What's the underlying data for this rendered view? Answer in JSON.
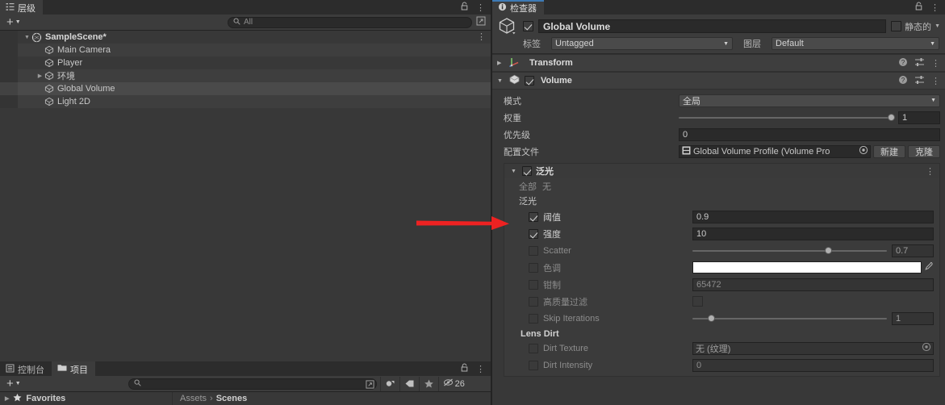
{
  "hierarchy": {
    "tab_label": "层级",
    "tab_icon": "hierarchy-icon",
    "lock_icon": "lock-icon",
    "menu_icon": "kebab-menu-icon",
    "add_label": "+",
    "search_placeholder": "All",
    "search_value": "",
    "items": [
      {
        "label": "SampleScene*",
        "icon": "unity-scene-icon",
        "depth": 0,
        "foldout": "open",
        "selected": false,
        "type": "scene"
      },
      {
        "label": "Main Camera",
        "icon": "gameobject-icon",
        "depth": 1,
        "foldout": "none",
        "selected": false,
        "type": "go"
      },
      {
        "label": "Player",
        "icon": "gameobject-icon",
        "depth": 1,
        "foldout": "none",
        "selected": false,
        "type": "go"
      },
      {
        "label": "环境",
        "icon": "gameobject-icon",
        "depth": 1,
        "foldout": "closed",
        "selected": false,
        "type": "go"
      },
      {
        "label": "Global Volume",
        "icon": "gameobject-icon",
        "depth": 1,
        "foldout": "none",
        "selected": true,
        "type": "go"
      },
      {
        "label": "Light 2D",
        "icon": "gameobject-icon",
        "depth": 1,
        "foldout": "none",
        "selected": false,
        "type": "go"
      }
    ]
  },
  "project_panel": {
    "tabs": [
      {
        "label": "控制台",
        "icon": "console-icon",
        "active": false
      },
      {
        "label": "项目",
        "icon": "folder-icon",
        "active": true
      }
    ],
    "lock_icon": "lock-icon",
    "menu_icon": "kebab-menu-icon",
    "add_label": "+",
    "search_value": "",
    "icon_buttons": [
      {
        "name": "search-expand-icon"
      },
      {
        "name": "asset-type-filter-icon"
      },
      {
        "name": "label-filter-icon"
      },
      {
        "name": "favorites-filter-icon"
      }
    ],
    "hidden_count": "26",
    "hidden_icon": "hidden-eye-icon",
    "favorites_label": "Favorites",
    "favorites_icon": "star-icon",
    "breadcrumb": [
      "Assets",
      "Scenes"
    ],
    "breadcrumb_sep": "›"
  },
  "inspector": {
    "tab_label": "检查器",
    "tab_icon": "info-icon",
    "lock_icon": "lock-icon",
    "menu_icon": "kebab-menu-icon",
    "object": {
      "icon": "prefab-cube-icon",
      "enabled": true,
      "name": "Global Volume",
      "static_label": "静态的",
      "static_checked": false,
      "tag_label": "标签",
      "tag_value": "Untagged",
      "layer_label": "图层",
      "layer_value": "Default"
    },
    "components": [
      {
        "title": "Transform",
        "icon": "transform-axis-icon",
        "expanded": false,
        "has_checkbox": false,
        "help_icon": "help-icon",
        "preset_icon": "preset-icon",
        "menu_icon": "kebab-menu-icon"
      },
      {
        "title": "Volume",
        "icon": "volume-icon",
        "expanded": true,
        "has_checkbox": true,
        "checked": true,
        "help_icon": "help-icon",
        "preset_icon": "preset-icon",
        "menu_icon": "kebab-menu-icon"
      }
    ],
    "volume": {
      "rows": [
        {
          "name": "模式",
          "type": "dropdown",
          "value": "全局"
        },
        {
          "name": "权重",
          "type": "slider",
          "value": "1",
          "fraction": 1.0
        },
        {
          "name": "优先级",
          "type": "text",
          "value": "0"
        },
        {
          "name": "配置文件",
          "type": "object",
          "value": "Global Volume Profile (Volume Pro",
          "icon": "profile-asset-icon",
          "pick_icon": "object-picker-icon",
          "buttons": [
            "新建",
            "克隆"
          ]
        }
      ]
    },
    "bloom": {
      "title": "泛光",
      "enabled": true,
      "expanded": true,
      "menu_icon": "kebab-menu-icon",
      "all_label": "全部",
      "none_label": "无",
      "group_label": "泛光",
      "rows": [
        {
          "name": "阈值",
          "override": true,
          "type": "text",
          "value": "0.9"
        },
        {
          "name": "强度",
          "override": true,
          "type": "text",
          "value": "10"
        },
        {
          "name": "Scatter",
          "override": false,
          "type": "slider",
          "value": "0.7",
          "fraction": 0.7
        },
        {
          "name": "色调",
          "override": false,
          "type": "color",
          "value": "#ffffff",
          "eyedropper_icon": "eyedropper-icon"
        },
        {
          "name": "钳制",
          "override": false,
          "type": "text",
          "value": "65472"
        },
        {
          "name": "高质量过滤",
          "override": false,
          "type": "checkbox",
          "checked": false
        },
        {
          "name": "Skip Iterations",
          "override": false,
          "type": "slider",
          "value": "1",
          "fraction": 0.08
        }
      ],
      "lens_dirt": {
        "label": "Lens Dirt",
        "rows": [
          {
            "name": "Dirt Texture",
            "override": false,
            "type": "object",
            "value": "无 (纹理)",
            "pick_icon": "object-picker-icon"
          },
          {
            "name": "Dirt Intensity",
            "override": false,
            "type": "text",
            "value": "0"
          }
        ]
      }
    }
  },
  "annotation": {
    "arrow_color": "#ee2222",
    "name": "red-pointer-arrow",
    "points_at": "阈值"
  }
}
